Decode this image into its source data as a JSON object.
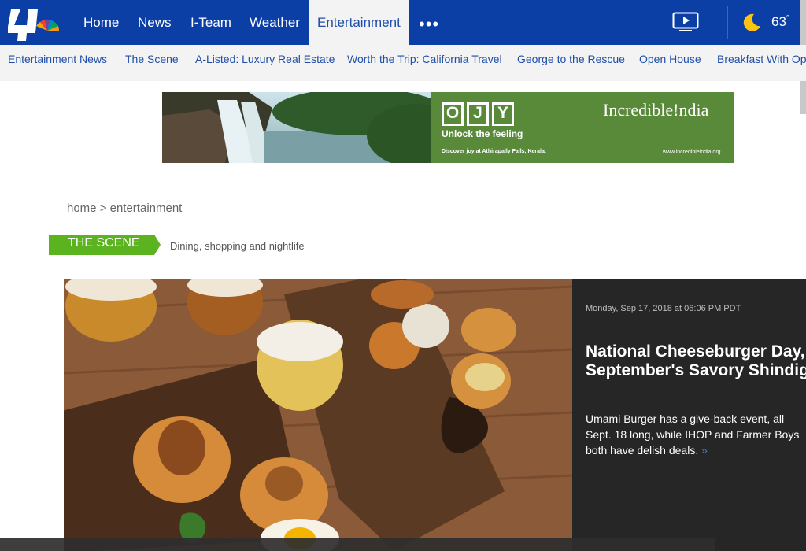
{
  "header": {
    "logo_name": "nbc-4-peacock-logo",
    "nav": [
      {
        "label": "Home"
      },
      {
        "label": "News"
      },
      {
        "label": "I-Team"
      },
      {
        "label": "Weather"
      },
      {
        "label": "Entertainment",
        "active": true
      }
    ],
    "more_label": "•••",
    "weather": {
      "temp": "63",
      "degree": "°",
      "icon": "moon-icon"
    },
    "colors": {
      "nav_bg": "#0b3fa5",
      "active_bg": "#f3f3f3",
      "link": "#1f4ea8"
    }
  },
  "subnav": {
    "items": [
      {
        "label": "Entertainment News"
      },
      {
        "label": "The Scene"
      },
      {
        "label": "A-Listed: Luxury Real Estate"
      },
      {
        "label": "Worth the Trip: California Travel"
      },
      {
        "label": "George to the Rescue"
      },
      {
        "label": "Open House"
      },
      {
        "label": "Breakfast With Ops"
      }
    ]
  },
  "ad": {
    "letters": [
      "O",
      "J",
      "Y"
    ],
    "tagline": "Unlock the feeling",
    "brand": "Incredible!ndia",
    "small_text": "Discover joy at Athirapally Falls, Kerala.",
    "url": "www.incredibleindia.org"
  },
  "breadcrumb": "home > entertainment",
  "section": {
    "badge": "THE SCENE",
    "subtitle": "Dining, shopping and nightlife",
    "badge_color": "#5cb320"
  },
  "hero": {
    "date": "Monday, Sep 17, 2018 at 06:06 PM PDT",
    "title_line1": "National Cheeseburger Day,",
    "title_line2": "September's Savory Shindig",
    "blurb": "Umami Burger has a give-back event, all Sept. 18 long, while IHOP and Farmer Boys both have delish deals.",
    "more_glyph": "»"
  }
}
